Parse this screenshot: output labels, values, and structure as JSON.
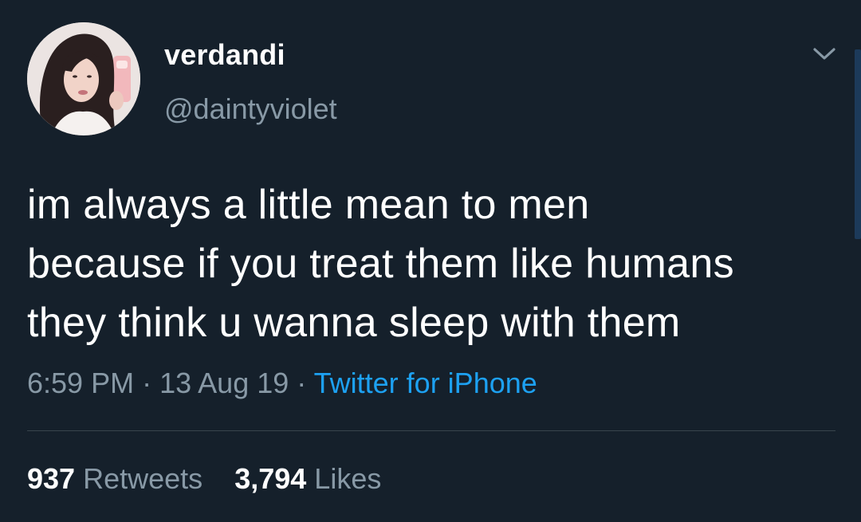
{
  "user": {
    "display_name": "verdandi",
    "handle": "@daintyviolet"
  },
  "tweet": {
    "text": "im always a little mean to men\nbecause if you treat them like humans\nthey think u wanna sleep with them",
    "time": "6:59 PM",
    "date": "13 Aug 19",
    "separator": "·",
    "source": "Twitter for iPhone"
  },
  "stats": {
    "retweets_count": "937",
    "retweets_label": "Retweets",
    "likes_count": "3,794",
    "likes_label": "Likes"
  },
  "icons": {
    "menu": "chevron-down-icon",
    "avatar": "profile-photo"
  },
  "colors": {
    "background": "#15202b",
    "secondary_text": "#8899a6",
    "link": "#1da1f2",
    "divider": "#38444d"
  }
}
